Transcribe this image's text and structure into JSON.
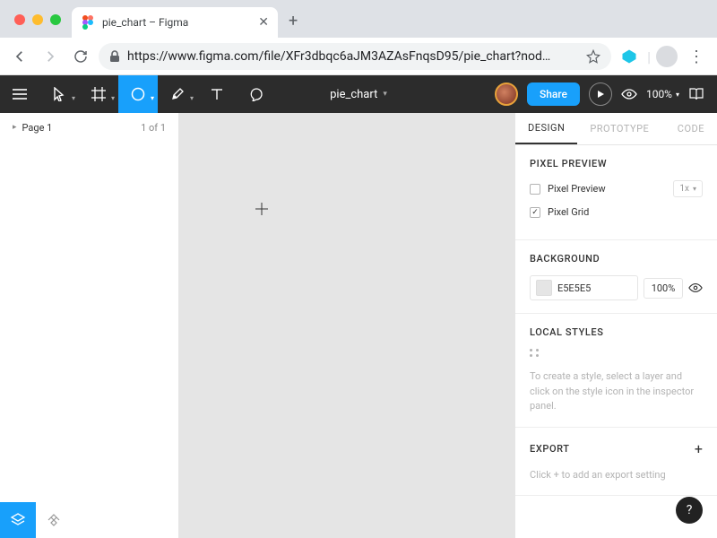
{
  "browser": {
    "tab_title": "pie_chart – Figma",
    "url": "https://www.figma.com/file/XFr3dbqc6aJM3AZAsFnqsD95/pie_chart?nod…"
  },
  "toolbar": {
    "doc_name": "pie_chart",
    "share_label": "Share",
    "zoom": "100%"
  },
  "left_panel": {
    "page_label": "Page 1",
    "page_count": "1 of 1"
  },
  "right_panel": {
    "tabs": {
      "design": "DESIGN",
      "prototype": "PROTOTYPE",
      "code": "CODE"
    },
    "pixel_preview": {
      "title": "PIXEL PREVIEW",
      "checkbox_label": "Pixel Preview",
      "scale": "1x",
      "grid_label": "Pixel Grid",
      "grid_checked": true
    },
    "background": {
      "title": "BACKGROUND",
      "hex": "E5E5E5",
      "opacity": "100%"
    },
    "local_styles": {
      "title": "LOCAL STYLES",
      "hint": "To create a style, select a layer and click on the style icon in the inspector panel."
    },
    "export": {
      "title": "EXPORT",
      "hint": "Click + to add an export setting"
    }
  },
  "help": "?"
}
